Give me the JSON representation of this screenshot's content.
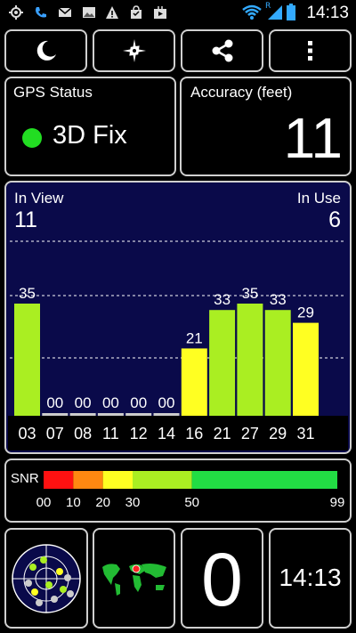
{
  "status_bar": {
    "time": "14:13",
    "network_type": "R",
    "left_icons": [
      "gps-icon",
      "phone-icon",
      "mail-icon",
      "image-icon",
      "warning-icon",
      "shopping-bag-icon",
      "play-store-icon"
    ],
    "right_icons": [
      "wifi-icon",
      "signal-icon",
      "battery-icon"
    ]
  },
  "toolbar": {
    "buttons": [
      {
        "name": "night-mode-icon"
      },
      {
        "name": "compass-icon"
      },
      {
        "name": "share-icon"
      },
      {
        "name": "overflow-menu-icon"
      }
    ]
  },
  "gps_status": {
    "label": "GPS Status",
    "value": "3D Fix",
    "indicator_color": "#22dd22"
  },
  "accuracy": {
    "label": "Accuracy (feet)",
    "value": "11"
  },
  "satellites": {
    "in_view_label": "In View",
    "in_view_value": "11",
    "in_use_label": "In Use",
    "in_use_value": "6"
  },
  "chart_data": {
    "type": "bar",
    "categories": [
      "03",
      "07",
      "08",
      "11",
      "12",
      "14",
      "16",
      "21",
      "27",
      "29",
      "31"
    ],
    "values": [
      35,
      0,
      0,
      0,
      0,
      0,
      21,
      33,
      35,
      33,
      29
    ],
    "data_labels": [
      "35",
      "00",
      "00",
      "00",
      "00",
      "00",
      "21",
      "33",
      "35",
      "33",
      "29"
    ],
    "colors": [
      "#aaee22",
      "#cccccc",
      "#cccccc",
      "#cccccc",
      "#cccccc",
      "#cccccc",
      "#ffff22",
      "#aaee22",
      "#aaee22",
      "#aaee22",
      "#ffff22"
    ],
    "ylim": [
      0,
      60
    ],
    "grid": true,
    "background": "#0a0a4a"
  },
  "snr_legend": {
    "label": "SNR",
    "ticks": [
      "00",
      "10",
      "20",
      "30",
      "50",
      "99"
    ],
    "segments": [
      {
        "from": 0,
        "to": 10,
        "color": "#ff1111"
      },
      {
        "from": 10,
        "to": 20,
        "color": "#ff8811"
      },
      {
        "from": 20,
        "to": 30,
        "color": "#ffff22"
      },
      {
        "from": 30,
        "to": 50,
        "color": "#aaee22"
      },
      {
        "from": 50,
        "to": 99,
        "color": "#22dd44"
      }
    ]
  },
  "bottom": {
    "compass_value": "0",
    "clock": "14:13"
  }
}
